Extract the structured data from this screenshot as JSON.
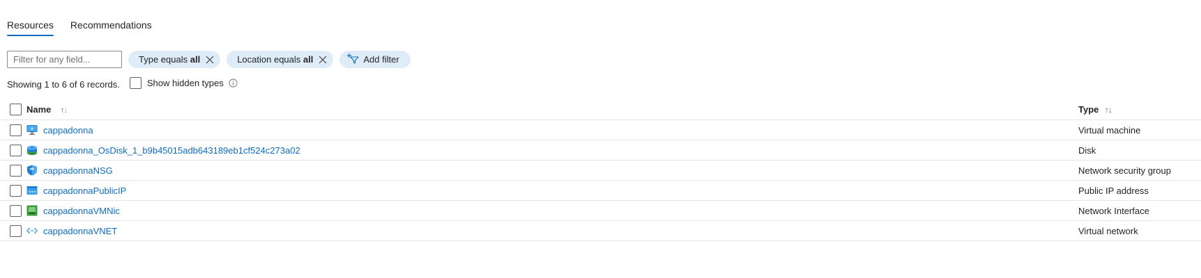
{
  "tabs": [
    {
      "label": "Resources",
      "active": true
    },
    {
      "label": "Recommendations",
      "active": false
    }
  ],
  "filters": {
    "search_placeholder": "Filter for any field...",
    "pills": [
      {
        "prefix": "Type equals",
        "value": "all"
      },
      {
        "prefix": "Location equals",
        "value": "all"
      }
    ],
    "add_filter_label": "Add filter"
  },
  "status": {
    "records_text": "Showing 1 to 6 of 6 records.",
    "show_hidden_label": "Show hidden types"
  },
  "table": {
    "columns": {
      "name": "Name",
      "type": "Type"
    },
    "rows": [
      {
        "name": "cappadonna",
        "type": "Virtual machine",
        "icon": "virtual-machine-icon"
      },
      {
        "name": "cappadonna_OsDisk_1_b9b45015adb643189eb1cf524c273a02",
        "type": "Disk",
        "icon": "disk-icon"
      },
      {
        "name": "cappadonnaNSG",
        "type": "Network security group",
        "icon": "network-security-group-icon"
      },
      {
        "name": "cappadonnaPublicIP",
        "type": "Public IP address",
        "icon": "public-ip-icon"
      },
      {
        "name": "cappadonnaVMNic",
        "type": "Network Interface",
        "icon": "network-interface-icon"
      },
      {
        "name": "cappadonnaVNET",
        "type": "Virtual network",
        "icon": "virtual-network-icon"
      }
    ]
  },
  "colors": {
    "accent": "#0f6cbd",
    "pill_bg": "#deecf9"
  }
}
